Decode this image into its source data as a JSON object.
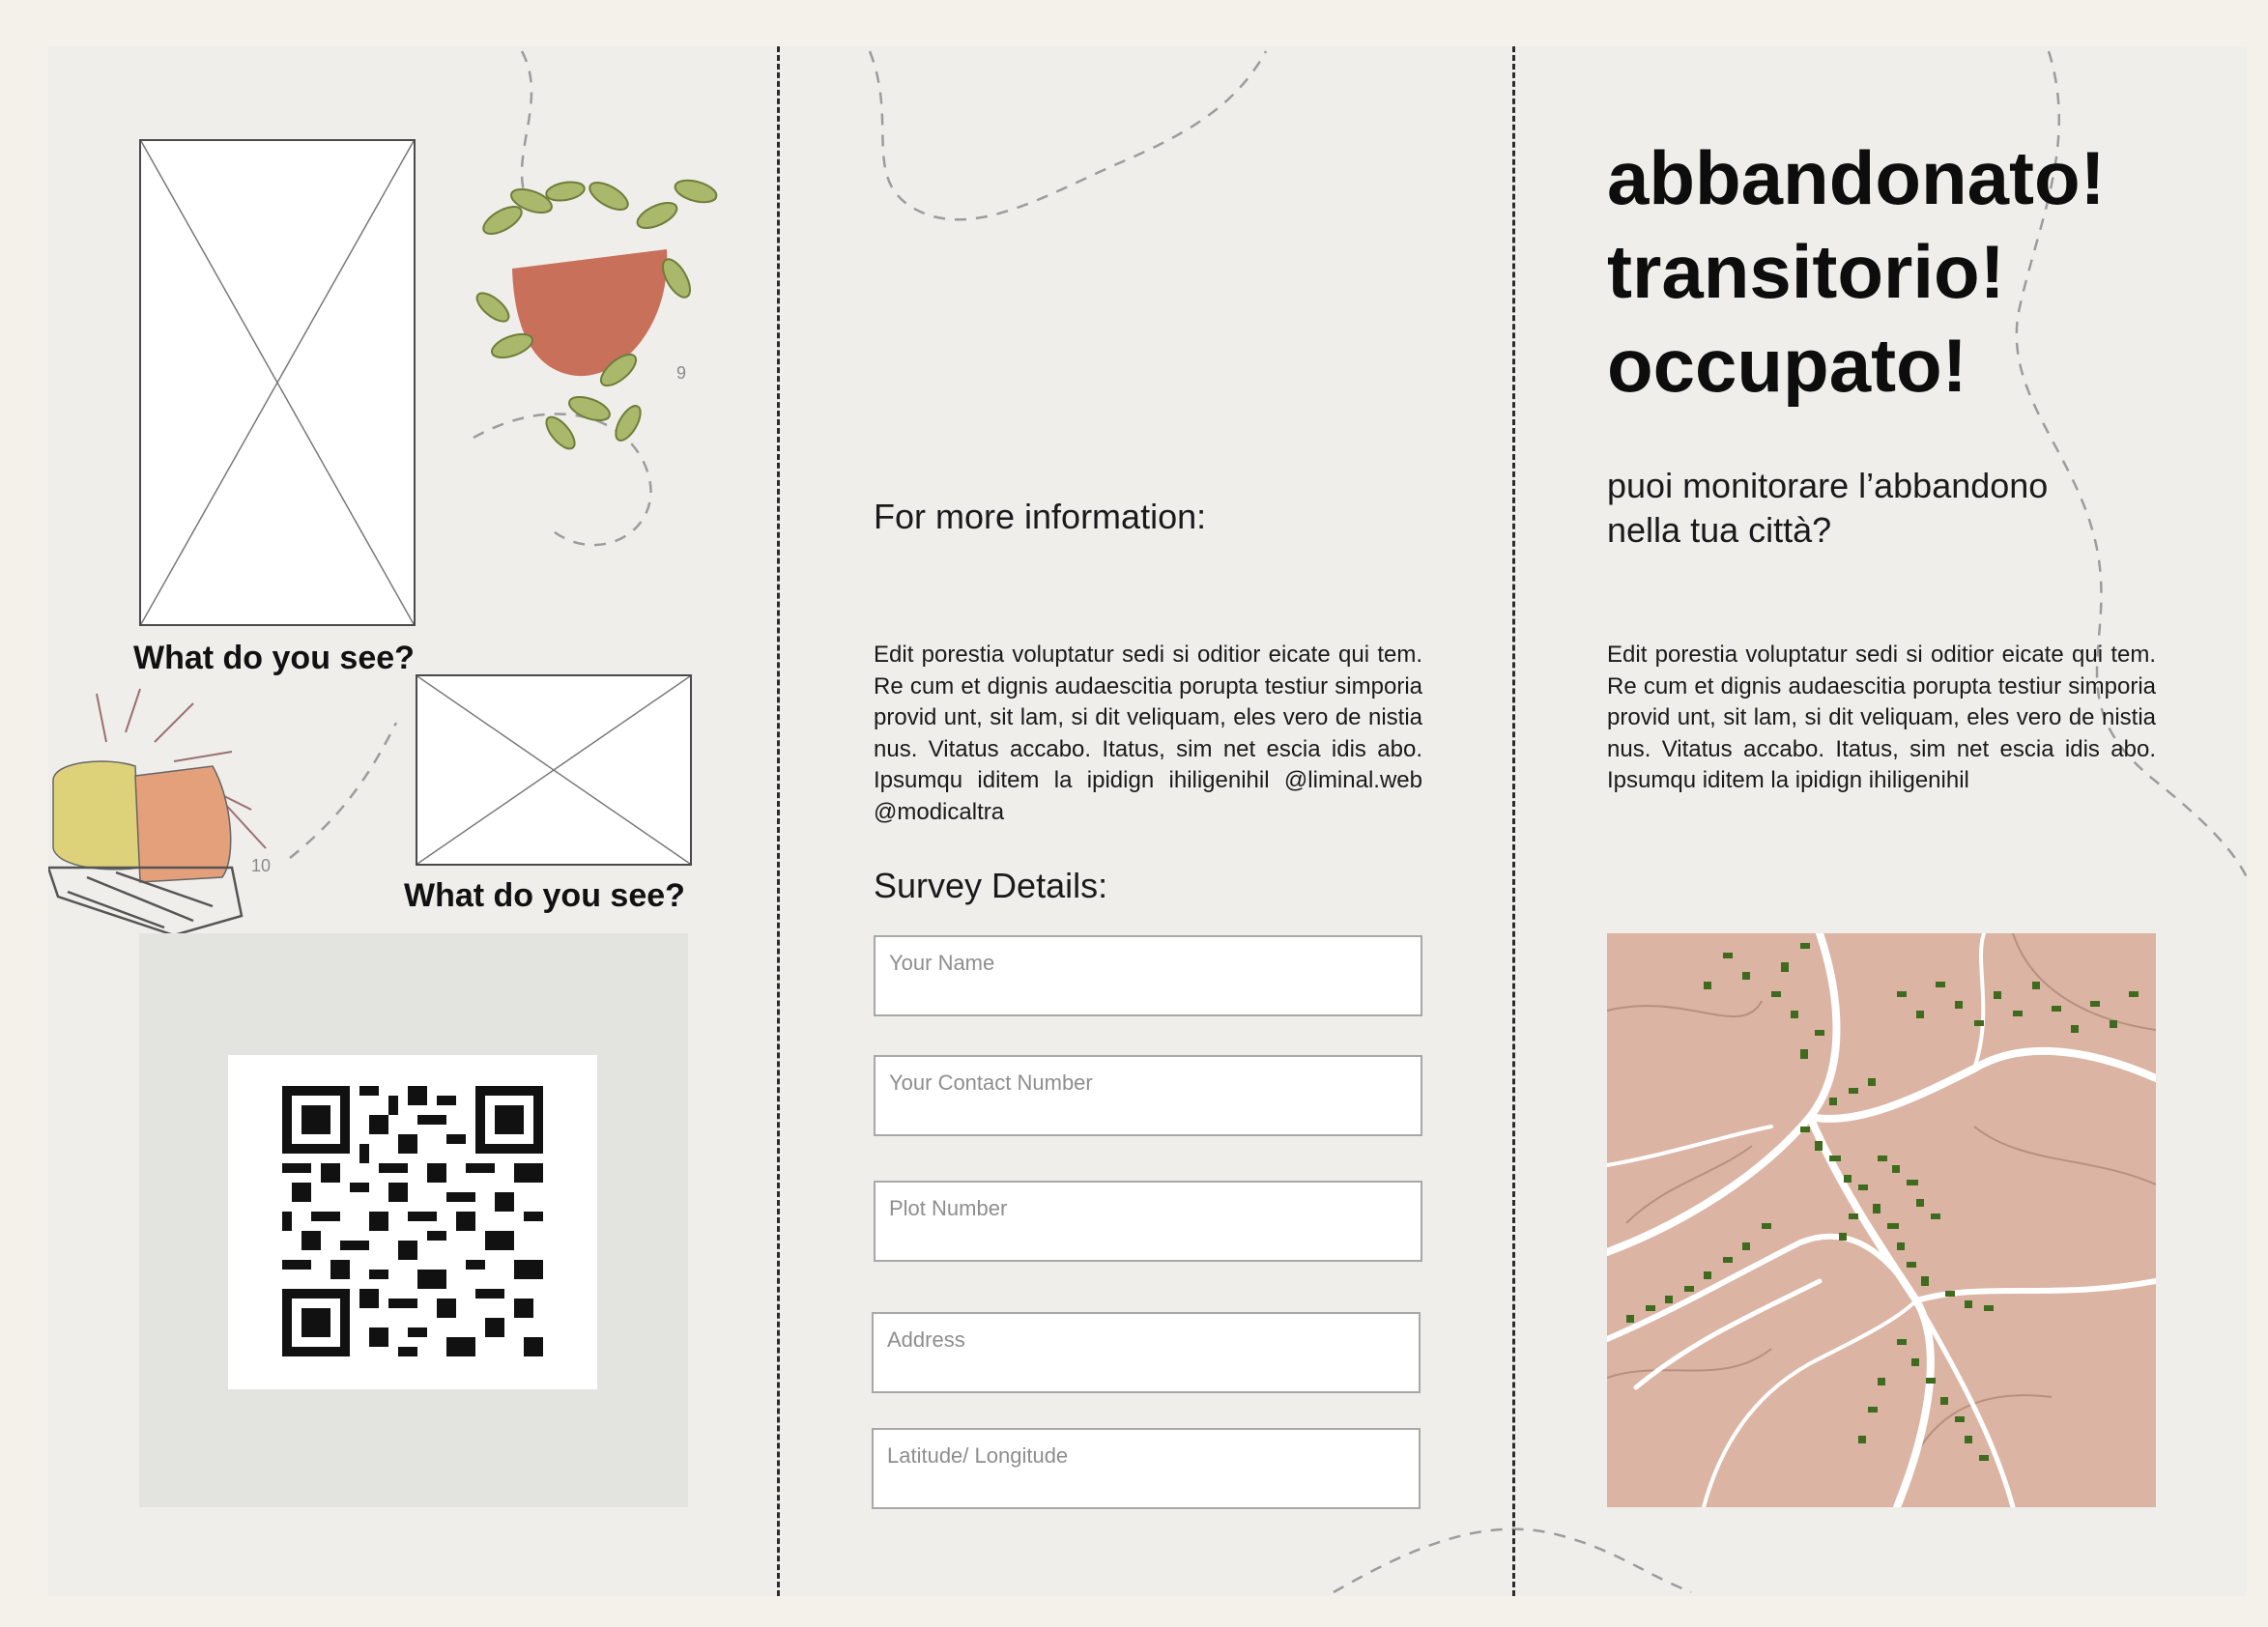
{
  "left_panel": {
    "caption_1": "What do you see?",
    "caption_2": "What do you see?",
    "plant_number_1": "9",
    "plant_number_2": "10",
    "qr_code_icon": "qr-code-icon"
  },
  "middle_panel": {
    "info_heading": "For more information:",
    "info_body": "Edit porestia voluptatur sedi si oditior eicate qui tem. Re cum et dignis audaescitia porupta testiur simporia provid unt, sit lam, si dit veliquam, eles vero de nistia nus. Vitatus accabo. Itatus, sim net escia idis abo. Ipsumqu iditem la ipidign ihiligenihil @liminal.web @modicaltra",
    "survey_heading": "Survey Details:",
    "fields": [
      {
        "placeholder": "Your Name"
      },
      {
        "placeholder": "Your Contact Number"
      },
      {
        "placeholder": "Plot Number"
      },
      {
        "placeholder": "Address"
      },
      {
        "placeholder": "Latitude/ Longitude"
      }
    ]
  },
  "right_panel": {
    "title_line_1": "abbandonato!",
    "title_line_2": "transitorio!",
    "title_line_3": "occupato!",
    "subtitle": "puoi monitorare l’abbandono nella tua città?",
    "body": "Edit porestia voluptatur sedi si oditior eicate qui tem. Re cum et dignis audaescitia porupta testiur simporia provid unt, sit lam, si dit veliquam, eles vero de nistia nus. Vitatus accabo. Itatus, sim net escia idis abo. Ipsumqu iditem la ipidign ihiligenihil"
  },
  "colors": {
    "paper": "#efeeeb",
    "map_land": "#dcb4a3",
    "map_buildings": "#3f6b1e",
    "pot_red": "#c9705a",
    "plant_green": "#a9b86a"
  }
}
